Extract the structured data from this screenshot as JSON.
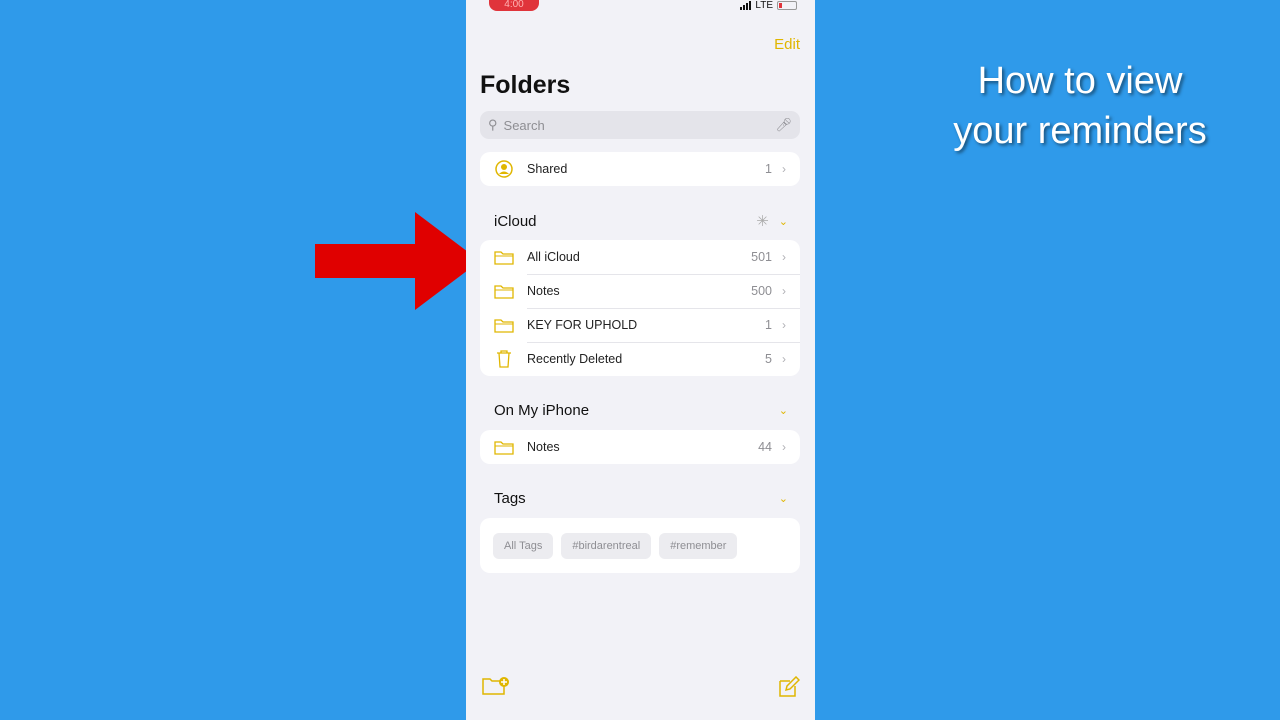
{
  "status": {
    "time_pill": "4:00",
    "network": "LTE"
  },
  "nav": {
    "edit": "Edit",
    "title": "Folders"
  },
  "search": {
    "placeholder": "Search"
  },
  "shared": {
    "label": "Shared",
    "count": "1"
  },
  "icloud": {
    "header": "iCloud",
    "items": [
      {
        "label": "All iCloud",
        "count": "501",
        "icon": "folder-icon"
      },
      {
        "label": "Notes",
        "count": "500",
        "icon": "folder-icon"
      },
      {
        "label": "KEY FOR UPHOLD",
        "count": "1",
        "icon": "folder-icon"
      },
      {
        "label": "Recently Deleted",
        "count": "5",
        "icon": "trash-icon"
      }
    ]
  },
  "on_my_iphone": {
    "header": "On My iPhone",
    "items": [
      {
        "label": "Notes",
        "count": "44",
        "icon": "folder-icon"
      }
    ]
  },
  "tags": {
    "header": "Tags",
    "items": [
      "All Tags",
      "#birdarentreal",
      "#remember"
    ]
  },
  "overlay": {
    "headline_line1": "How to view",
    "headline_line2": "your reminders"
  },
  "colors": {
    "background": "#2f9aea",
    "accent": "#e0b600",
    "arrow": "#e00000"
  }
}
